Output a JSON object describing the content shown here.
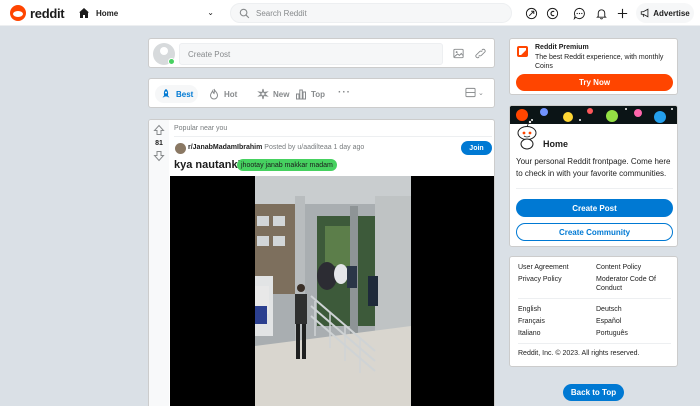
{
  "header": {
    "logo_text": "reddit",
    "home_label": "Home",
    "search_placeholder": "Search Reddit",
    "advertise_label": "Advertise",
    "icons": [
      "popular-icon",
      "coins-icon",
      "chat-icon",
      "notifications-icon",
      "plus-icon",
      "megaphone-icon"
    ]
  },
  "create_post": {
    "placeholder": "Create Post"
  },
  "sort": {
    "items": [
      {
        "label": "Best",
        "active": true
      },
      {
        "label": "Hot",
        "active": false
      },
      {
        "label": "New",
        "active": false
      },
      {
        "label": "Top",
        "active": false
      }
    ],
    "more": "···"
  },
  "post": {
    "near_label": "Popular near you",
    "score": "81",
    "subreddit": "r/JanabMadamIbrahim",
    "byline": "· Posted by u/aadilteaa 1 day ago",
    "join_label": "Join",
    "title": "kya nautanki",
    "flair": "jhootay janab makkar madam"
  },
  "premium": {
    "title": "Reddit Premium",
    "description": "The best Reddit experience, with monthly Coins",
    "button": "Try Now"
  },
  "home_card": {
    "title": "Home",
    "description": "Your personal Reddit frontpage. Come here to check in with your favorite communities.",
    "create_post": "Create Post",
    "create_community": "Create Community"
  },
  "footer": {
    "links": {
      "user_agreement": "User Agreement",
      "content_policy": "Content Policy",
      "privacy_policy": "Privacy Policy",
      "moderator_code": "Moderator Code Of Conduct",
      "english": "English",
      "deutsch": "Deutsch",
      "francais": "Français",
      "espanol": "Español",
      "italiano": "Italiano",
      "portugues": "Português"
    },
    "copyright": "Reddit, Inc. © 2023. All rights reserved."
  },
  "back_to_top": "Back to Top",
  "colors": {
    "brand": "#ff4500",
    "accent": "#0079d3",
    "flair": "#46d160",
    "background": "#dae0e6"
  }
}
